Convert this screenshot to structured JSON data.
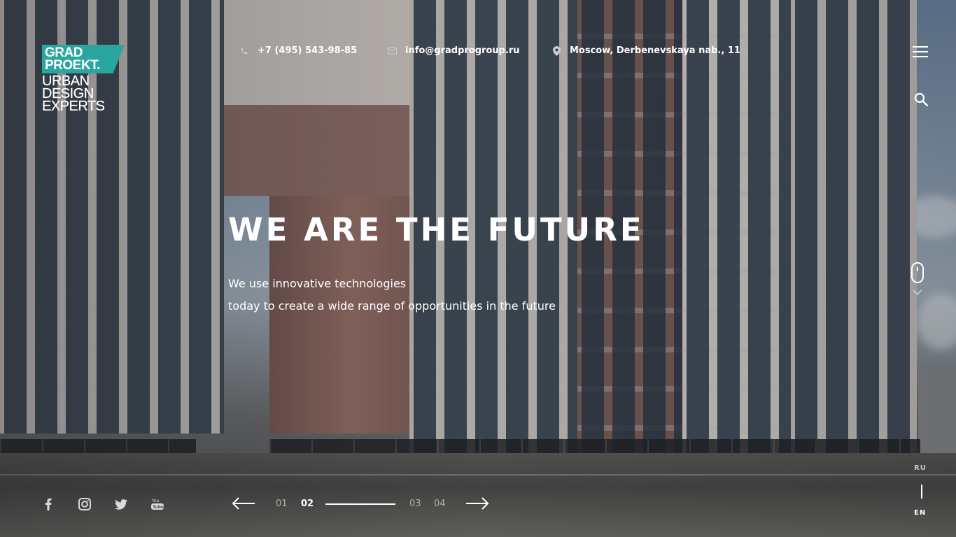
{
  "brand": {
    "logo_line1": "GRAD",
    "logo_line2": "PROEKT.",
    "tagline": [
      "URBAN",
      "DESIGN",
      "EXPERTS"
    ],
    "accent_color": "#2aa6a0"
  },
  "header": {
    "phone": {
      "icon": "phone-icon",
      "text": "+7 (495) 543-98-85"
    },
    "email": {
      "icon": "mail-icon",
      "text": "info@gradprogroup.ru"
    },
    "address": {
      "icon": "location-pin-icon",
      "text": "Moscow, Derbenevskaya nab., 11"
    },
    "menu_icon": "hamburger-menu-icon",
    "search_icon": "search-icon"
  },
  "hero": {
    "title": "WE ARE THE FUTURE",
    "text_line1": "We use innovative technologies",
    "text_line2": "today to create a wide range of opportunities in the future"
  },
  "scroll_indicator": {
    "icon": "mouse-scroll-icon",
    "arrow": "chevron-down-icon"
  },
  "language": {
    "options": [
      "RU",
      "EN"
    ],
    "selected": "EN"
  },
  "social": [
    "facebook-icon",
    "instagram-icon",
    "twitter-icon",
    "youtube-icon"
  ],
  "slider": {
    "prev_icon": "arrow-left-icon",
    "next_icon": "arrow-right-icon",
    "slides": [
      "01",
      "02",
      "03",
      "04"
    ],
    "current": "02"
  }
}
